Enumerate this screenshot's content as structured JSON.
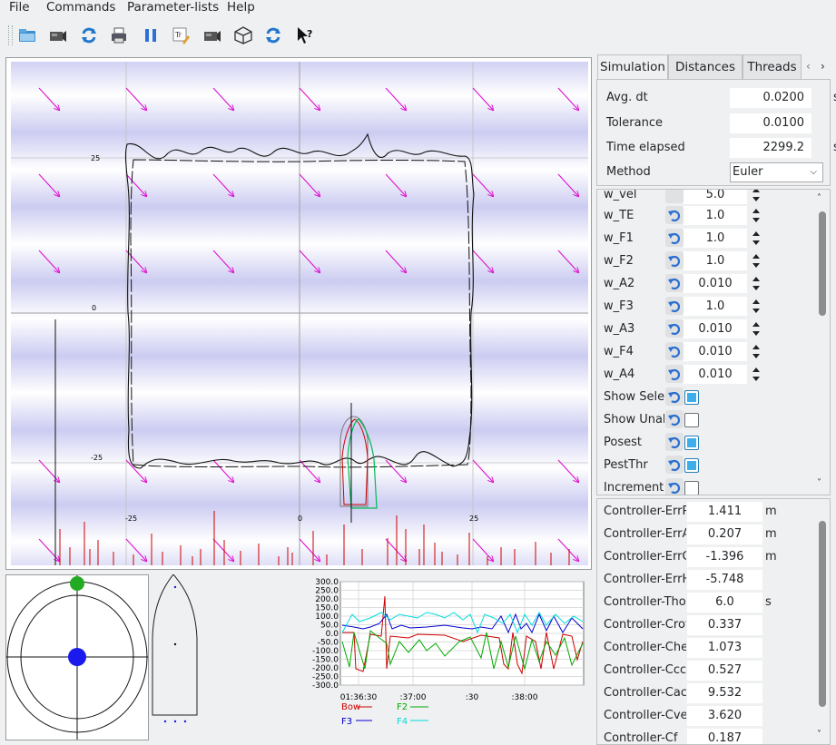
{
  "menu": [
    "File",
    "Commands",
    "Parameter-lists",
    "Help"
  ],
  "toolbar_icons": [
    "open-folder-icon",
    "camera-icon",
    "refresh-icon",
    "printer-icon",
    "pause-icon",
    "edit-text-icon",
    "camera2-icon",
    "cube-icon",
    "refresh2-icon",
    "whats-this-icon"
  ],
  "plot": {
    "y_ticks": [
      "25",
      "0",
      "-25"
    ],
    "x_ticks": [
      "-25",
      "0",
      "25"
    ]
  },
  "timeplot": {
    "y_ticks": [
      "300.0",
      "250.0",
      "200.0",
      "150.0",
      "100.0",
      "50.0",
      "0.0",
      "-50.0",
      "-100.0",
      "-150.0",
      "-200.0",
      "-250.0",
      "-300.0"
    ],
    "x_ticks": [
      "01:36:30",
      ":37:00",
      ":30",
      ":38:00"
    ],
    "legend": [
      {
        "name": "Bow",
        "color": "#cc0000"
      },
      {
        "name": "F2",
        "color": "#00aa00"
      },
      {
        "name": "F3",
        "color": "#0000cc"
      },
      {
        "name": "F4",
        "color": "#00dddd"
      }
    ]
  },
  "tabs": [
    "Simulation",
    "Distances",
    "Threads"
  ],
  "simulation": [
    {
      "label": "Avg. dt",
      "value": "0.0200",
      "unit": "s"
    },
    {
      "label": "Tolerance",
      "value": "0.0100",
      "unit": ""
    },
    {
      "label": "Time elapsed",
      "value": "2299.2",
      "unit": "s"
    }
  ],
  "method": {
    "label": "Method",
    "value": "Euler"
  },
  "params_partial": {
    "label": "w_vel",
    "value": "5.0"
  },
  "params": [
    {
      "label": "w_TE",
      "value": "1.0"
    },
    {
      "label": "w_F1",
      "value": "1.0"
    },
    {
      "label": "w_F2",
      "value": "1.0"
    },
    {
      "label": "w_A2",
      "value": "0.010"
    },
    {
      "label": "w_F3",
      "value": "1.0"
    },
    {
      "label": "w_A3",
      "value": "0.010"
    },
    {
      "label": "w_F4",
      "value": "0.010"
    },
    {
      "label": "w_A4",
      "value": "0.010"
    }
  ],
  "checks": [
    {
      "label": "Show Selected",
      "checked": true
    },
    {
      "label": "Show Unalloc",
      "checked": false
    },
    {
      "label": "Posest",
      "checked": true
    },
    {
      "label": "PestThr",
      "checked": true
    },
    {
      "label": "Incremental",
      "checked": false
    }
  ],
  "controller": [
    {
      "label": "Controller-ErrPos",
      "value": "1.411",
      "unit": "m"
    },
    {
      "label": "Controller-ErrAcross",
      "value": "0.207",
      "unit": "m"
    },
    {
      "label": "Controller-ErrCourse",
      "value": "-1.396",
      "unit": "m"
    },
    {
      "label": "Controller-ErrHeading",
      "value": "-5.748",
      "unit": ""
    },
    {
      "label": "Controller-Thorizon",
      "value": "6.0",
      "unit": "s"
    },
    {
      "label": "Controller-Crot",
      "value": "0.337",
      "unit": ""
    },
    {
      "label": "Controller-Chead",
      "value": "1.073",
      "unit": ""
    },
    {
      "label": "Controller-Ccc",
      "value": "0.527",
      "unit": ""
    },
    {
      "label": "Controller-Cac",
      "value": "9.532",
      "unit": ""
    },
    {
      "label": "Controller-Cvel",
      "value": "3.620",
      "unit": ""
    },
    {
      "label": "Controller-Cf",
      "value": "0.187",
      "unit": ""
    }
  ]
}
